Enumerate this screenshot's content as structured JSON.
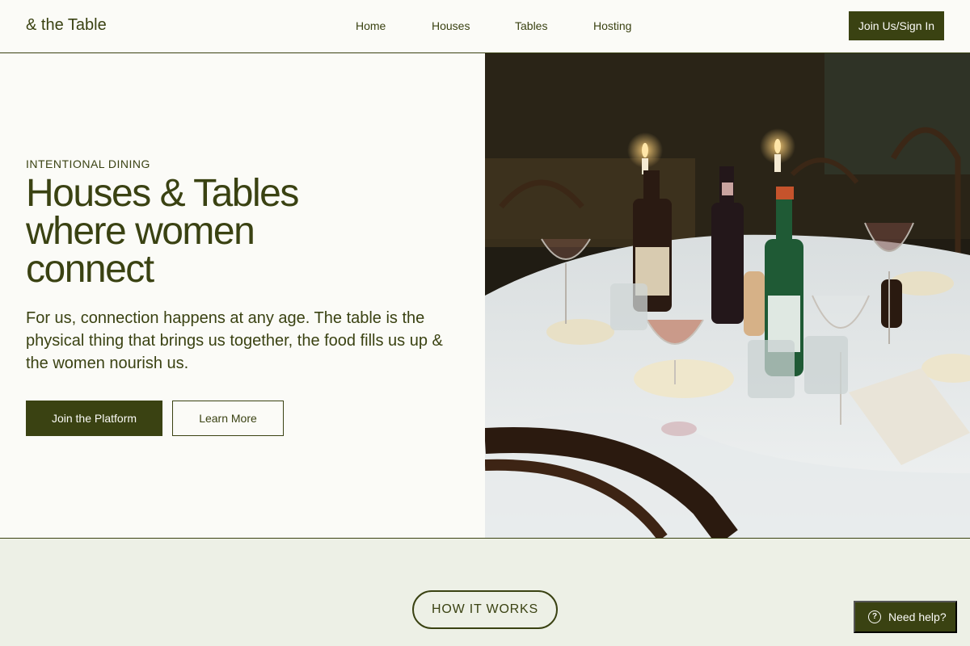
{
  "brand": {
    "logo": "& the Table"
  },
  "nav": {
    "items": [
      "Home",
      "Houses",
      "Tables",
      "Hosting"
    ]
  },
  "header": {
    "join_label": "Join Us/Sign In"
  },
  "hero": {
    "eyebrow": "INTENTIONAL DINING",
    "headline_lines": [
      "Houses & Tables",
      "where women",
      "connect"
    ],
    "intro": "For us, connection happens at any age. The table is the physical thing that brings us together, the food fills us up & the women nourish us.",
    "primary_cta": "Join the Platform",
    "secondary_cta": "Learn More"
  },
  "how_it_works": {
    "label": "HOW IT WORKS"
  },
  "help": {
    "label": "Need help?",
    "icon": "question-circle-icon"
  },
  "colors": {
    "brand": "#3a4212",
    "background": "#fbfbf7",
    "section_bg": "#edf0e6"
  }
}
